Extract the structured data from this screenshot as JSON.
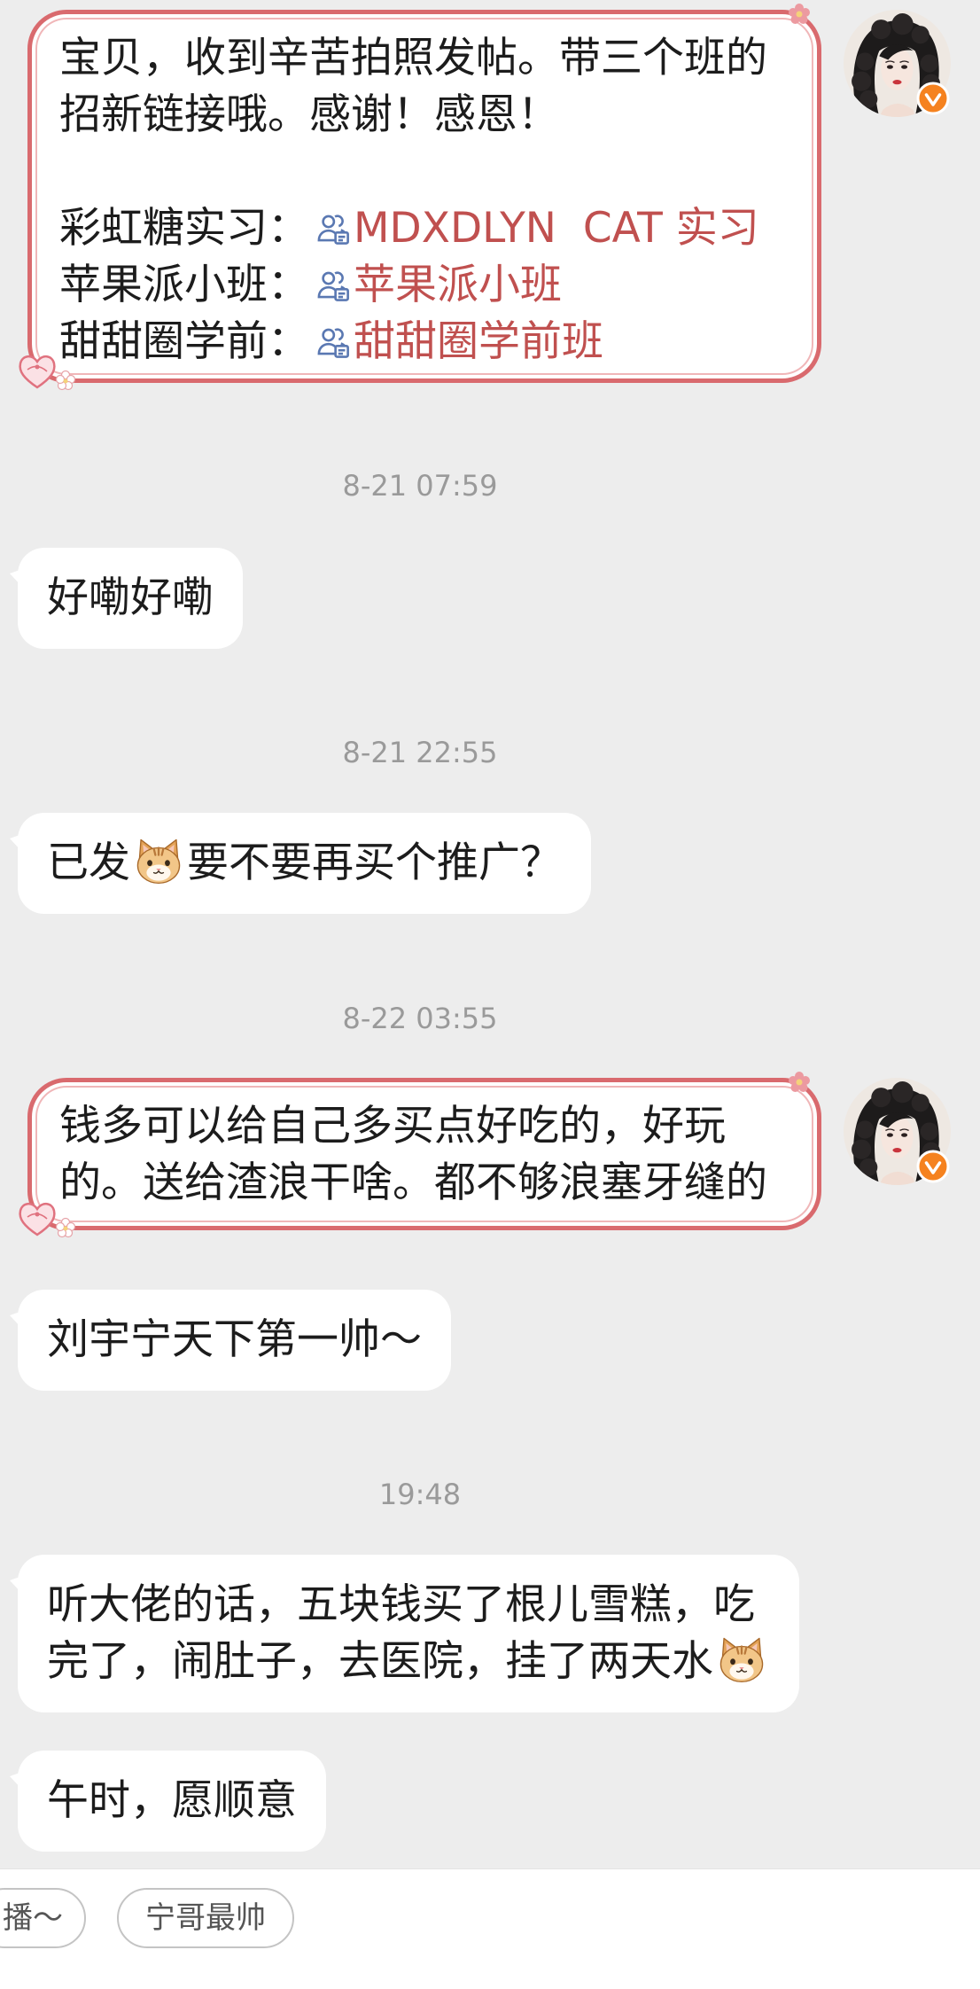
{
  "colors": {
    "page_background": "#ededed",
    "bubble_background": "#ffffff",
    "outgoing_border": "#d96a6e",
    "link_text": "#c0504f",
    "link_icon": "#5a78b2",
    "timestamp_text": "#9a9a9a",
    "verified_badge": "#f5821f",
    "chip_border": "#c4c4c4"
  },
  "icons": {
    "avatar": "user-avatar-icon",
    "verified_badge": "verified-badge-icon",
    "group_link": "group-chat-icon",
    "emoji": "cat-face-emoji-icon",
    "bubble_decorations": [
      "heart-ribbon-icon",
      "flower-icon"
    ]
  },
  "chat": {
    "msg1": {
      "lines": [
        "宝贝，收到辛苦拍照发帖。带三个班的",
        "招新链接哦。感谢！感恩！"
      ],
      "links": [
        {
          "label": "彩虹糖实习：",
          "text": "MDXDLYN  CAT 实习"
        },
        {
          "label": "苹果派小班：",
          "text": "苹果派小班"
        },
        {
          "label": "甜甜圈学前：",
          "text": "甜甜圈学前班"
        }
      ]
    },
    "time1": "8-21 07:59",
    "msg2": {
      "text": "好嘞好嘞"
    },
    "time2": "8-21 22:55",
    "msg3": {
      "text_before_emoji": "已发",
      "text_after_emoji": "要不要再买个推广？"
    },
    "time3": "8-22 03:55",
    "msg4": {
      "lines": [
        "钱多可以给自己多买点好吃的，好玩",
        "的。送给渣浪干啥。都不够浪塞牙缝的"
      ]
    },
    "msg5": {
      "text": "刘宇宁天下第一帅～"
    },
    "time4": "19:48",
    "msg6": {
      "lines": [
        "听大佬的话，五块钱买了根儿雪糕，吃",
        "完了，闹肚子，去医院，挂了两天水"
      ]
    },
    "msg7": {
      "text": "午时，愿顺意"
    }
  },
  "quick_replies": [
    "播～",
    "宁哥最帅"
  ]
}
